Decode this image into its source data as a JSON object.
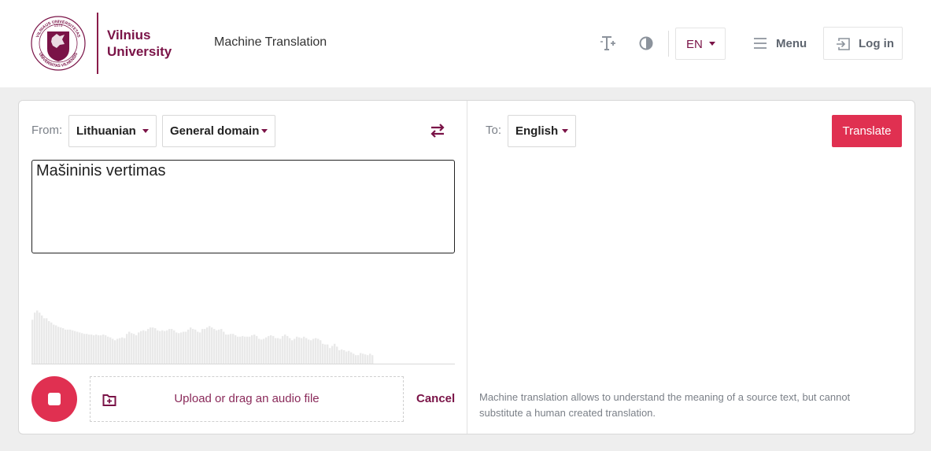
{
  "header": {
    "logo_line1": "Vilnius",
    "logo_line2": "University",
    "seal_year": "1579",
    "app_title": "Machine Translation",
    "language": "EN",
    "menu_label": "Menu",
    "login_label": "Log in",
    "icons": [
      "text-size-icon",
      "contrast-icon",
      "hamburger-icon",
      "login-icon"
    ]
  },
  "source": {
    "from_label": "From:",
    "language": "Lithuanian",
    "domain": "General domain",
    "text": "Mašininis vertimas",
    "upload_label": "Upload or drag an audio file",
    "cancel_label": "Cancel",
    "waveform": [
      0.62,
      0.72,
      0.75,
      0.72,
      0.68,
      0.64,
      0.64,
      0.6,
      0.58,
      0.55,
      0.54,
      0.52,
      0.51,
      0.5,
      0.48,
      0.48,
      0.48,
      0.47,
      0.46,
      0.45,
      0.44,
      0.43,
      0.42,
      0.42,
      0.41,
      0.41,
      0.4,
      0.41,
      0.4,
      0.4,
      0.41,
      0.4,
      0.38,
      0.37,
      0.35,
      0.33,
      0.35,
      0.36,
      0.37,
      0.36,
      0.42,
      0.45,
      0.43,
      0.42,
      0.4,
      0.44,
      0.46,
      0.47,
      0.46,
      0.49,
      0.51,
      0.51,
      0.5,
      0.47,
      0.46,
      0.47,
      0.46,
      0.47,
      0.49,
      0.49,
      0.47,
      0.44,
      0.43,
      0.44,
      0.45,
      0.45,
      0.48,
      0.51,
      0.49,
      0.48,
      0.45,
      0.44,
      0.49,
      0.49,
      0.51,
      0.53,
      0.51,
      0.49,
      0.47,
      0.48,
      0.49,
      0.45,
      0.41,
      0.41,
      0.42,
      0.42,
      0.4,
      0.38,
      0.38,
      0.39,
      0.38,
      0.38,
      0.38,
      0.4,
      0.41,
      0.39,
      0.35,
      0.34,
      0.35,
      0.37,
      0.39,
      0.4,
      0.39,
      0.36,
      0.36,
      0.35,
      0.39,
      0.41,
      0.39,
      0.36,
      0.33,
      0.35,
      0.38,
      0.37,
      0.36,
      0.38,
      0.36,
      0.34,
      0.33,
      0.35,
      0.36,
      0.35,
      0.33,
      0.28,
      0.27,
      0.27,
      0.22,
      0.25,
      0.28,
      0.24,
      0.19,
      0.2,
      0.19,
      0.17,
      0.18,
      0.16,
      0.14,
      0.12,
      0.12,
      0.15,
      0.14,
      0.13,
      0.12,
      0.14,
      0.12
    ],
    "colors": {
      "wave_bar": "#e9e9e9",
      "wave_baseline": "#d8d8d8"
    }
  },
  "target": {
    "to_label": "To:",
    "language": "English",
    "translate_label": "Translate",
    "disclaimer": "Machine translation allows to understand the meaning of a source text, but cannot substitute a human created translation."
  },
  "colors": {
    "brand": "#7a1347",
    "accent": "#e03051",
    "muted_text": "#7b8088",
    "page_bg": "#eeeeee"
  }
}
